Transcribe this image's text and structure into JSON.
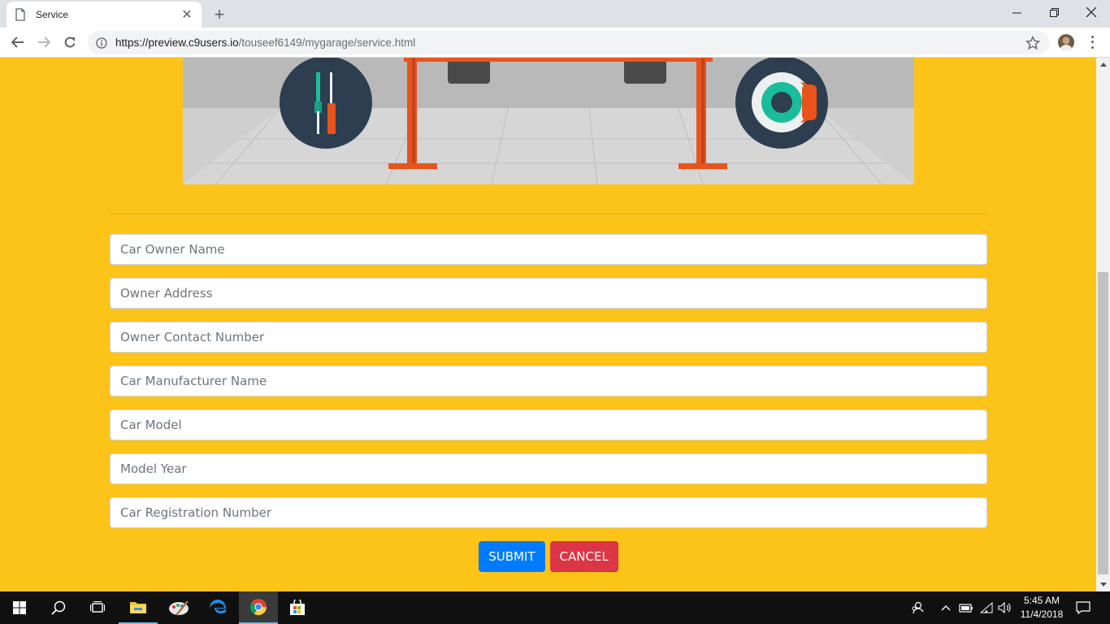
{
  "browser": {
    "tab_title": "Service",
    "url_host": "https://preview.c9users.io",
    "url_path": "/touseef6149/mygarage/service.html"
  },
  "form": {
    "fields": [
      {
        "placeholder": "Car Owner Name"
      },
      {
        "placeholder": "Owner Address"
      },
      {
        "placeholder": "Owner Contact Number"
      },
      {
        "placeholder": "Car Manufacturer Name"
      },
      {
        "placeholder": "Car Model"
      },
      {
        "placeholder": "Model Year"
      },
      {
        "placeholder": "Car Registration Number"
      }
    ],
    "submit_label": "SUBMIT",
    "cancel_label": "CANCEL"
  },
  "colors": {
    "page_background": "#fcc419",
    "submit_button": "#007bff",
    "cancel_button": "#dc3545",
    "lift_orange": "#e8541c",
    "icon_circle": "#2c3e50"
  },
  "taskbar": {
    "time": "5:45 AM",
    "date": "11/4/2018",
    "apps": [
      "windows-start-icon",
      "search-icon",
      "task-view-icon",
      "file-explorer-icon",
      "paint-icon",
      "edge-icon",
      "chrome-icon",
      "store-icon"
    ]
  }
}
